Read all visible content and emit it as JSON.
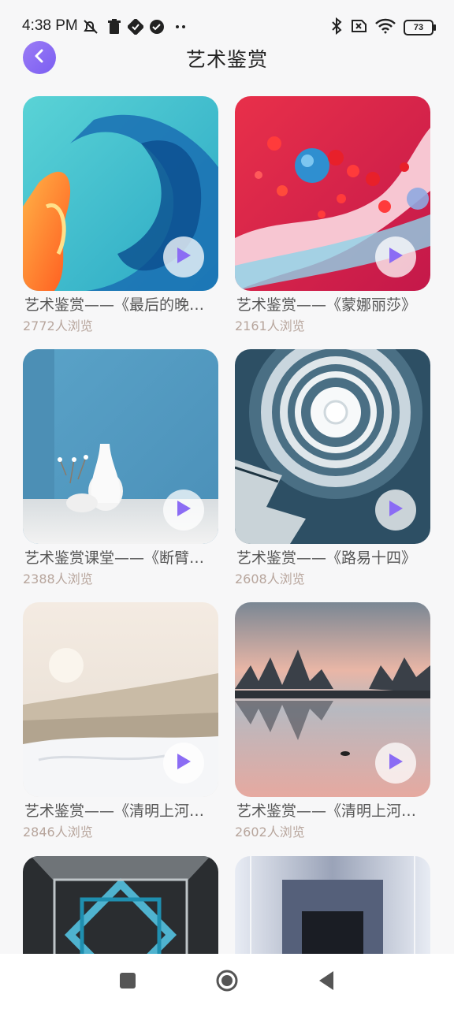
{
  "status": {
    "time": "4:38 PM",
    "battery": "73"
  },
  "header": {
    "title": "艺术鉴赏"
  },
  "cards": [
    {
      "title": "艺术鉴赏——《最后的晚餐》",
      "views": "2772人浏览"
    },
    {
      "title": "艺术鉴赏——《蒙娜丽莎》",
      "views": "2161人浏览"
    },
    {
      "title": "艺术鉴赏课堂——《断臂的维纳斯》",
      "views": "2388人浏览"
    },
    {
      "title": "艺术鉴赏——《路易十四》",
      "views": "2608人浏览"
    },
    {
      "title": "艺术鉴赏——《清明上河图》",
      "views": "2846人浏览"
    },
    {
      "title": "艺术鉴赏——《清明上河图》",
      "views": "2602人浏览"
    },
    {
      "title": "",
      "views": ""
    },
    {
      "title": "",
      "views": ""
    }
  ],
  "icons": {
    "back": "chevron-left-icon",
    "play": "play-icon",
    "nav_recent": "square-icon",
    "nav_home": "circle-icon",
    "nav_back": "triangle-back-icon"
  },
  "colors": {
    "accent": "#8b6cf4",
    "views_text": "#b7a59c"
  }
}
